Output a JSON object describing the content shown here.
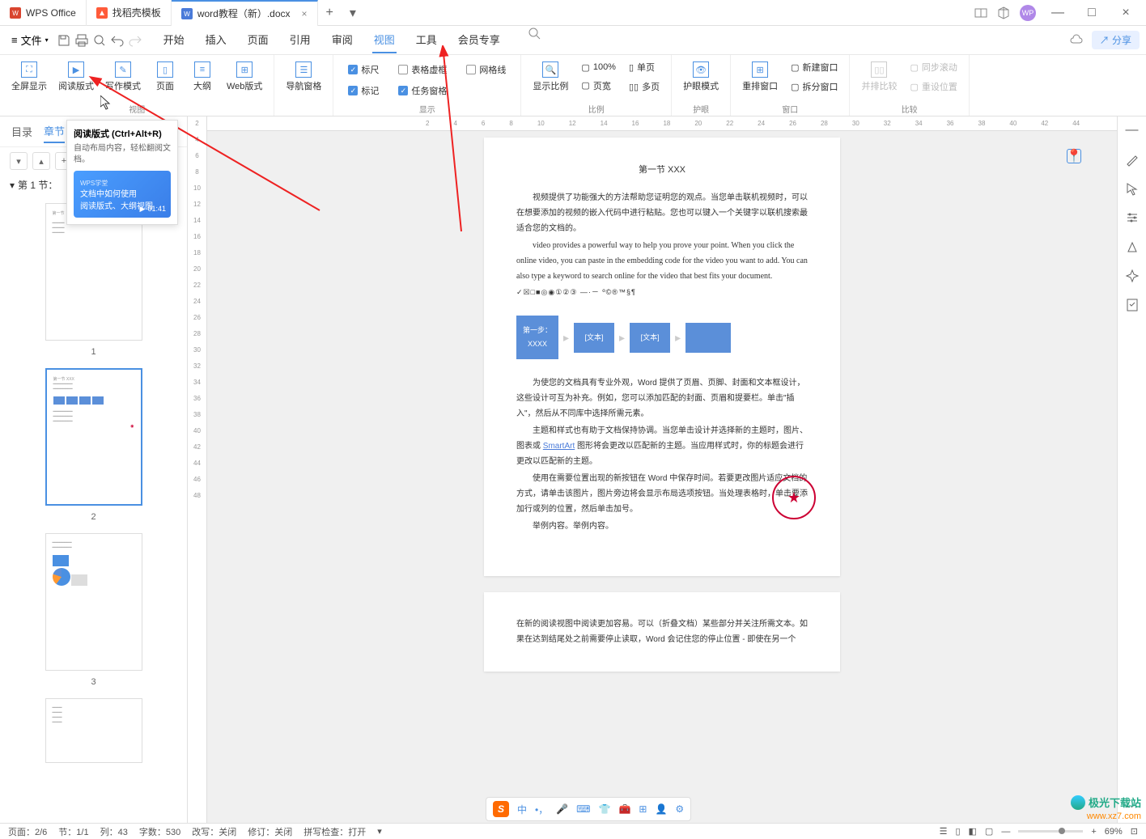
{
  "titlebar": {
    "tabs": [
      {
        "icon": "wps",
        "label": "WPS Office"
      },
      {
        "icon": "docer",
        "label": "找稻壳模板"
      },
      {
        "icon": "word",
        "label": "word教程（新）.docx",
        "active": true
      }
    ],
    "avatar": "WP"
  },
  "menubar": {
    "file": "文件",
    "tabs": [
      "开始",
      "插入",
      "页面",
      "引用",
      "审阅",
      "视图",
      "工具",
      "会员专享"
    ],
    "active": "视图",
    "share": "分享"
  },
  "ribbon": {
    "g1": {
      "fullscreen": "全屏显示",
      "read": "阅读版式",
      "write": "写作模式",
      "page": "页面",
      "outline": "大纲",
      "web": "Web版式"
    },
    "g2": {
      "nav": "导航窗格"
    },
    "g3": {
      "ruler": "标尺",
      "tablevirt": "表格虚框",
      "mark": "标记",
      "taskpane": "任务窗格",
      "grid": "网格线",
      "label": "显示"
    },
    "g4": {
      "zoom": "显示比例",
      "p100": "100%",
      "pagewidth": "页宽",
      "single": "单页",
      "multi": "多页",
      "label": "比例"
    },
    "g5": {
      "eye": "护眼模式",
      "label": "护眼"
    },
    "g6": {
      "rearrange": "重排窗口",
      "newwin": "新建窗口",
      "split": "拆分窗口",
      "label": "窗口"
    },
    "g7": {
      "sidebyside": "并排比较",
      "syncscroll": "同步滚动",
      "resetpos": "重设位置",
      "label": "比较"
    }
  },
  "tooltip": {
    "title": "阅读版式 (Ctrl+Alt+R)",
    "desc": "自动布局内容，轻松翻阅文档。",
    "vid_tag": "WPS学堂",
    "vid_title1": "文档中如何使用",
    "vid_title2": "阅读版式、大纲视图",
    "time": "01:41"
  },
  "leftpanel": {
    "tabs": {
      "toc": "目录",
      "chapter": "章节"
    },
    "section": "第 1 节：",
    "thumbs": [
      "1",
      "2",
      "3"
    ]
  },
  "hruler": [
    "2",
    "4",
    "6",
    "8",
    "10",
    "12",
    "14",
    "16",
    "18",
    "20",
    "22",
    "24",
    "26",
    "28",
    "30",
    "32",
    "34",
    "36",
    "38",
    "40",
    "42",
    "44"
  ],
  "vruler": [
    "2",
    "4",
    "6",
    "8",
    "10",
    "12",
    "14",
    "16",
    "18",
    "20",
    "22",
    "24",
    "26",
    "28",
    "30",
    "32",
    "34",
    "36",
    "38",
    "40",
    "42",
    "44",
    "46",
    "48"
  ],
  "doc": {
    "title": "第一节 XXX",
    "p1": "视频提供了功能强大的方法帮助您证明您的观点。当您单击联机视频时，可以在想要添加的视频的嵌入代码中进行粘贴。您也可以键入一个关键字以联机搜索最适合您的文档的。",
    "p2": "video provides a powerful way to help you prove your point. When you click the online video, you can paste in the embedding code for the video you want to add. You can also type a keyword to search online for the video that best fits your document.",
    "symbols": "✓☒□■◎◉①②③ —·－    º©®™§¶",
    "flow": {
      "s1a": "第一步：",
      "s1b": "XXXX",
      "s2": "[文本]",
      "s3": "[文本]"
    },
    "p3": "为使您的文档具有专业外观，Word 提供了页眉、页脚、封面和文本框设计，这些设计可互为补充。例如，您可以添加匹配的封面、页眉和提要栏。单击\"插入\"，然后从不同库中选择所需元素。",
    "p4": "主题和样式也有助于文档保持协调。当您单击设计并选择新的主题时，图片、图表或 SmartArt 图形将会更改以匹配新的主题。当应用样式时，你的标题会进行更改以匹配新的主题。",
    "smartart": "SmartArt",
    "p5": "使用在需要位置出现的新按钮在 Word 中保存时间。若要更改图片适应文档的方式，请单击该图片，图片旁边将会显示布局选项按钮。当处理表格时，单击要添加行或列的位置，然后单击加号。",
    "p6": "举例内容。举例内容。",
    "page2_p1_a": "在新的阅读视图中阅读更加容易。可以（折叠文档）某些部分并关注所需文本。如果在达到结尾处之前需要停止读取，Word 会记住您的停止位置 - 即使在另一个"
  },
  "ime": {
    "lang": "中"
  },
  "statusbar": {
    "page": "页面：2/6",
    "section": "节：1/1",
    "col": "列：43",
    "words": "字数：530",
    "changes": "改写：关闭",
    "revise": "修订：关闭",
    "spell": "拼写检查：打开",
    "zoom": "69%"
  },
  "watermark": {
    "brand": "极光下载站",
    "url": "www.xz7.com"
  }
}
